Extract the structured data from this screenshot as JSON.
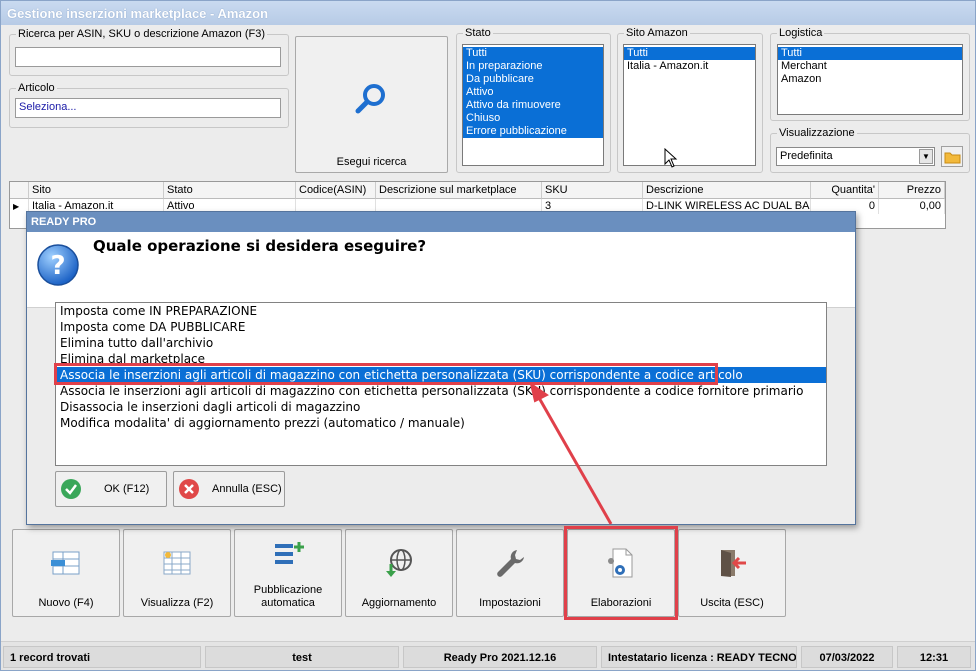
{
  "window": {
    "title": "Gestione inserzioni marketplace - Amazon"
  },
  "search": {
    "label": "Ricerca per ASIN, SKU o descrizione Amazon (F3)",
    "value": ""
  },
  "articolo": {
    "label": "Articolo",
    "value": "Seleziona..."
  },
  "search_button": {
    "label": "Esegui ricerca"
  },
  "stato": {
    "label": "Stato",
    "items": [
      "Tutti",
      "In preparazione",
      "Da pubblicare",
      "Attivo",
      "Attivo da rimuovere",
      "Chiuso",
      "Errore pubblicazione"
    ]
  },
  "sito": {
    "label": "Sito Amazon",
    "items": [
      "Tutti",
      "Italia - Amazon.it"
    ]
  },
  "logistica": {
    "label": "Logistica",
    "items": [
      "Tutti",
      "Merchant",
      "Amazon"
    ]
  },
  "visualizzazione": {
    "label": "Visualizzazione",
    "value": "Predefinita"
  },
  "grid": {
    "headers": [
      "Sito",
      "Stato",
      "Codice(ASIN)",
      "Descrizione sul marketplace",
      "SKU",
      "Descrizione",
      "Quantita'",
      "Prezzo"
    ],
    "rows": [
      [
        "Italia - Amazon.it",
        "Attivo",
        "",
        "",
        "3",
        "D-LINK WIRELESS AC DUAL BA...",
        "0",
        "0,00"
      ]
    ]
  },
  "dialog": {
    "title": "READY PRO",
    "question": "Quale operazione si desidera eseguire?",
    "options": [
      "Imposta come IN PREPARAZIONE",
      "Imposta come DA PUBBLICARE",
      "Elimina tutto dall'archivio",
      "Elimina dal marketplace",
      "Associa le inserzioni agli articoli di magazzino con etichetta personalizzata (SKU) corrispondente a codice articolo",
      "Associa le inserzioni agli articoli di magazzino con etichetta personalizzata (SKU) corrispondente a codice fornitore primario",
      "Disassocia le inserzioni dagli articoli di magazzino",
      "Modifica modalita' di aggiornamento prezzi (automatico / manuale)"
    ],
    "ok_label": "OK (F12)",
    "cancel_label": "Annulla (ESC)"
  },
  "toolbar": {
    "nuovo": "Nuovo (F4)",
    "visualizza": "Visualizza (F2)",
    "pubblicazione_1": "Pubblicazione",
    "pubblicazione_2": "automatica",
    "aggiornamento": "Aggiornamento",
    "impostazioni": "Impostazioni",
    "elaborazioni": "Elaborazioni",
    "uscita": "Uscita (ESC)"
  },
  "status": {
    "records": "1 record trovati",
    "user": "test",
    "version": "Ready Pro 2021.12.16",
    "license": "Intestatario licenza : READY TECNO",
    "date": "07/03/2022",
    "time": "12:31"
  },
  "colors": {
    "selection": "#0a6fd6",
    "highlight": "#e0404a",
    "title_gradient": "#b7cbe6"
  }
}
